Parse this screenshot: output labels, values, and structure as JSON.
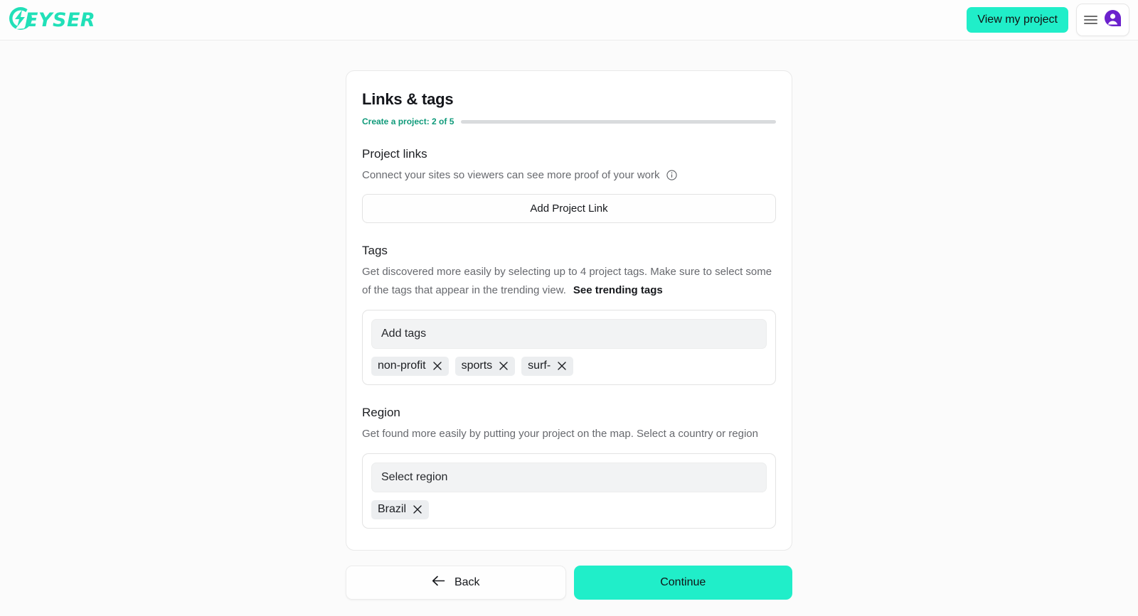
{
  "header": {
    "logo_text": "EYSER",
    "logo_icon": "geyser-bolt-logo",
    "view_project_label": "View my project",
    "menu_icon": "hamburger-icon",
    "avatar_icon": "user-avatar-icon",
    "accent_color": "#20eec9",
    "avatar_color": "#6b21cd"
  },
  "card": {
    "title": "Links & tags",
    "progress_label": "Create a project: 2 of 5",
    "progress_percent": 40,
    "progress_fill_color": "#14a07d",
    "progress_track_color": "#d9dbdd"
  },
  "project_links": {
    "heading": "Project links",
    "description": "Connect your sites so viewers can see more proof of your work",
    "info_icon": "info-circle-icon",
    "add_button_label": "Add Project Link"
  },
  "tags": {
    "heading": "Tags",
    "description": "Get discovered more easily by selecting up to 4 project tags. Make sure to select some of the tags that appear in the trending view.",
    "trending_link_label": "See trending tags",
    "input_placeholder": "Add tags",
    "chips": [
      {
        "label": "non-profit",
        "remove_icon": "close-icon"
      },
      {
        "label": "sports",
        "remove_icon": "close-icon"
      },
      {
        "label": "surf-",
        "remove_icon": "close-icon"
      }
    ]
  },
  "region": {
    "heading": "Region",
    "description": "Get found more easily by putting your project on the map. Select a country or region",
    "input_placeholder": "Select region",
    "chips": [
      {
        "label": "Brazil",
        "remove_icon": "close-icon"
      }
    ]
  },
  "footer_actions": {
    "back_label": "Back",
    "back_icon": "arrow-left-icon",
    "continue_label": "Continue"
  }
}
